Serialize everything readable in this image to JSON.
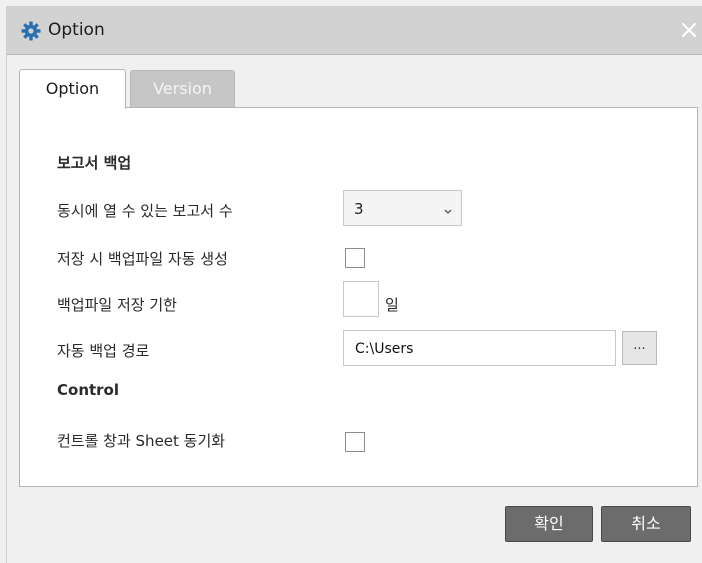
{
  "window": {
    "title": "Option",
    "icon": "gear-icon",
    "close_icon": "close-icon"
  },
  "tabs": [
    {
      "label": "Option",
      "active": true
    },
    {
      "label": "Version",
      "active": false
    }
  ],
  "backup": {
    "section_title": "보고서 백업",
    "concurrent_label": "동시에 열 수 있는 보고서 수",
    "concurrent_value": "3",
    "auto_backup_label": "저장 시 백업파일 자동 생성",
    "retention_label": "백업파일 저장 기한",
    "retention_value": "",
    "retention_unit": "일",
    "path_label": "자동 백업 경로",
    "path_value": "C:\\Users",
    "browse_label": "..."
  },
  "control": {
    "section_title": "Control",
    "sync_label": "컨트롤 창과 Sheet 동기화"
  },
  "buttons": {
    "ok": "확인",
    "cancel": "취소"
  },
  "colors": {
    "titlebar": "#d2d2d2",
    "accent_icon": "#2a6fb0",
    "button": "#6c6c6c"
  }
}
